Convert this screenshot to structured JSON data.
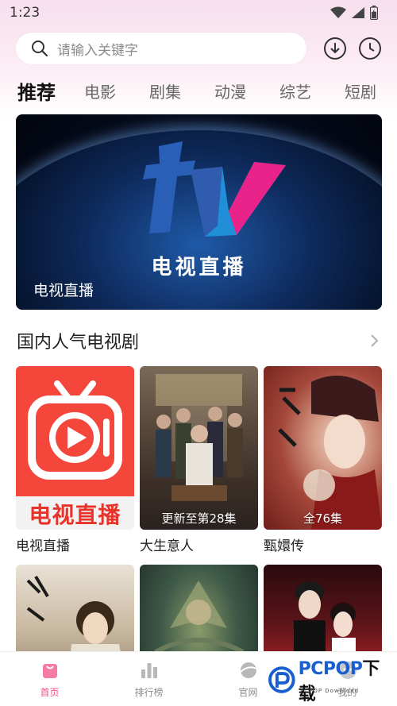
{
  "status_bar": {
    "time": "1:23",
    "icons": [
      "wifi-icon",
      "signal-icon",
      "battery-icon"
    ]
  },
  "search": {
    "placeholder": "请输入关键字",
    "icons": [
      "search-icon",
      "download-icon",
      "history-icon"
    ]
  },
  "tabs": [
    {
      "label": "推荐",
      "active": true
    },
    {
      "label": "电影",
      "active": false
    },
    {
      "label": "剧集",
      "active": false
    },
    {
      "label": "动漫",
      "active": false
    },
    {
      "label": "综艺",
      "active": false
    },
    {
      "label": "短剧",
      "active": false
    }
  ],
  "banner": {
    "logo_text": "电视直播",
    "caption": "电视直播"
  },
  "section": {
    "title": "国内人气电视剧"
  },
  "cards": [
    {
      "title": "电视直播",
      "poster_text": "电视直播",
      "badge": ""
    },
    {
      "title": "大生意人",
      "poster_text": "",
      "badge": "更新至第28集"
    },
    {
      "title": "甄嬛传",
      "poster_text": "",
      "badge": "全76集"
    },
    {
      "title": "",
      "badge": ""
    },
    {
      "title": "",
      "badge": ""
    },
    {
      "title": "",
      "badge": ""
    }
  ],
  "bottom_nav": [
    {
      "label": "首页",
      "icon": "home-icon",
      "active": true
    },
    {
      "label": "排行榜",
      "icon": "ranking-icon",
      "active": false
    },
    {
      "label": "官网",
      "icon": "website-icon",
      "active": false
    },
    {
      "label": "我的",
      "icon": "profile-icon",
      "active": false
    }
  ],
  "watermark": {
    "text": "PCPOP",
    "text2": "下载",
    "sub": "PCPOP Download"
  },
  "colors": {
    "accent": "#f0548a",
    "tvapp_red": "#f5463c",
    "watermark_blue": "#1a5fd0"
  }
}
